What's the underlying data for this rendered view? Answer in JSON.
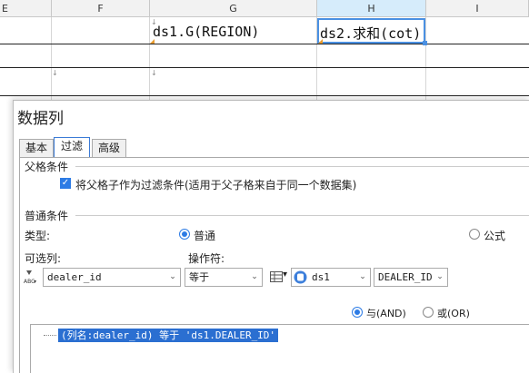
{
  "sheet": {
    "columns": [
      "E",
      "F",
      "G",
      "H",
      "I"
    ],
    "cells": {
      "g1": "ds1.G(REGION)",
      "h1": "ds2.求和(cot)"
    }
  },
  "dialog": {
    "title": "数据列",
    "tabs": [
      "基本",
      "过滤",
      "高级"
    ],
    "active_tab": "过滤",
    "parent_section_label": "父格条件",
    "parent_checkbox_label": "将父格子作为过滤条件(适用于父子格来自于同一个数据集)",
    "parent_checkbox_checked": true,
    "normal_section_label": "普通条件",
    "type_label": "类型:",
    "type_normal": "普通",
    "type_formula": "公式",
    "type_selected": "普通",
    "optional_columns_label": "可选列:",
    "operator_label": "操作符:",
    "column_value": "dealer_id",
    "operator_value": "等于",
    "dataset_value": "ds1",
    "dataset_column_value": "DEALER_ID",
    "and_label": "与(AND)",
    "or_label": "或(OR)",
    "logic_selected": "与(AND)",
    "condition_item": "(列名:dealer_id) 等于 'ds1.DEALER_ID'"
  }
}
